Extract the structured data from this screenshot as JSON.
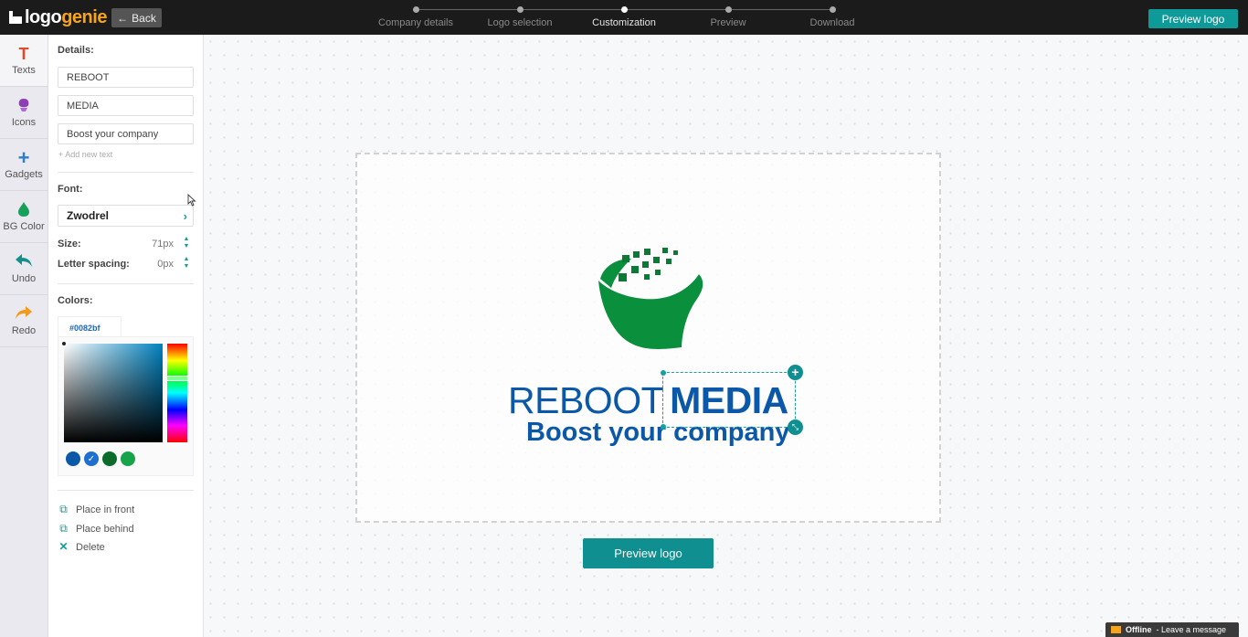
{
  "header": {
    "logo_part1": "logo",
    "logo_part2": "genie",
    "back_label": "Back",
    "steps": [
      "Company details",
      "Logo selection",
      "Customization",
      "Preview",
      "Download"
    ],
    "active_step": "Customization",
    "preview_label": "Preview logo"
  },
  "tools": [
    {
      "label": "Texts",
      "icon": "text-icon"
    },
    {
      "label": "Icons",
      "icon": "icons-icon"
    },
    {
      "label": "Gadgets",
      "icon": "plus-icon"
    },
    {
      "label": "BG Color",
      "icon": "droplet-icon"
    },
    {
      "label": "Undo",
      "icon": "undo-icon"
    },
    {
      "label": "Redo",
      "icon": "redo-icon"
    }
  ],
  "panel": {
    "details_label": "Details:",
    "texts": [
      "REBOOT",
      "MEDIA",
      "Boost your company"
    ],
    "add_text_label": "+ Add new text",
    "font_label": "Font:",
    "font_value": "Zwodrel",
    "size_label": "Size:",
    "size_value": "71px",
    "spacing_label": "Letter spacing:",
    "spacing_value": "0px",
    "colors_label": "Colors:",
    "color_hex": "#0082bf",
    "swatches": [
      "#0b57a8",
      "#1e6fd0",
      "#0b6b2b",
      "#16a34a"
    ],
    "actions": {
      "place_front": "Place in front",
      "place_behind": "Place behind",
      "delete": "Delete"
    }
  },
  "canvas": {
    "wordmark_1": "REBOOT",
    "wordmark_2": "MEDIA",
    "tagline": "Boost your company",
    "preview_label": "Preview logo",
    "brand_blue": "#0b57a8",
    "brand_green": "#0a8f3c"
  },
  "chat": {
    "status": "Offline",
    "message": "- Leave a message"
  },
  "colors": {
    "accent": "#0f9a9a",
    "logo_orange": "#f7a31c"
  }
}
